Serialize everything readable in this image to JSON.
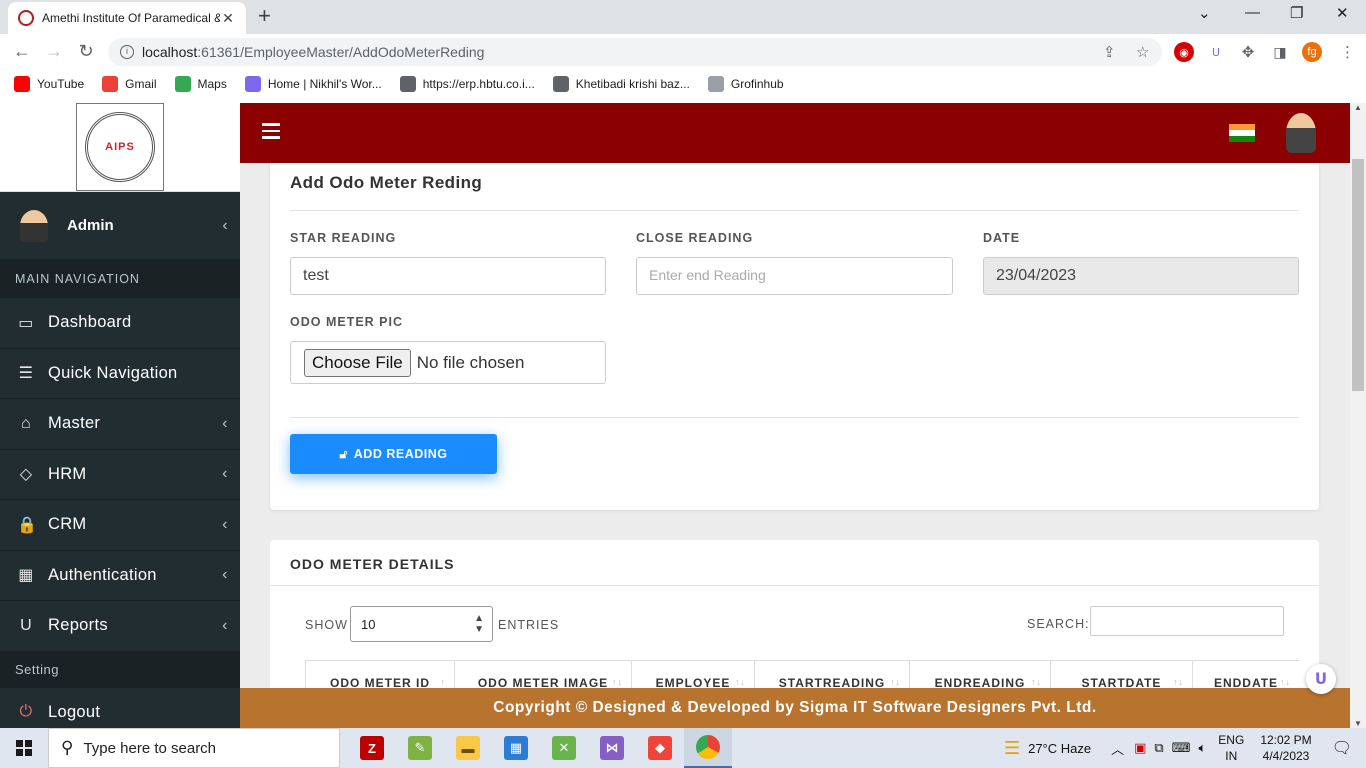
{
  "browser": {
    "tab_title": "Amethi Institute Of Paramedical &",
    "url_host": "localhost",
    "url_rest": ":61361/EmployeeMaster/AddOdoMeterReding",
    "profile_initials": "fg"
  },
  "bookmarks": [
    {
      "label": "YouTube",
      "color": "#ff0000",
      "icon": "youtube-icon"
    },
    {
      "label": "Gmail",
      "color": "#ea4335",
      "icon": "gmail-icon"
    },
    {
      "label": "Maps",
      "color": "#34a853",
      "icon": "maps-icon"
    },
    {
      "label": "Home | Nikhil's Wor...",
      "color": "#7b68ee",
      "icon": "clickup-icon"
    },
    {
      "label": "https://erp.hbtu.co.i...",
      "color": "#5f6368",
      "icon": "globe-icon"
    },
    {
      "label": "Khetibadi krishi baz...",
      "color": "#5f6368",
      "icon": "globe-icon"
    },
    {
      "label": "Grofinhub",
      "color": "#9aa0a6",
      "icon": "page-icon"
    }
  ],
  "sidebar": {
    "logo_text": "AIPS",
    "user_name": "Admin",
    "nav_header": "MAIN NAVIGATION",
    "items": [
      {
        "label": "Dashboard",
        "icon": "▭",
        "has_arrow": false
      },
      {
        "label": "Quick Navigation",
        "icon": "☰",
        "has_arrow": false
      },
      {
        "label": "Master",
        "icon": "⌂",
        "has_arrow": true
      },
      {
        "label": "HRM",
        "icon": "◇",
        "has_arrow": true
      },
      {
        "label": "CRM",
        "icon": "🔒",
        "has_arrow": true
      },
      {
        "label": "Authentication",
        "icon": "▦",
        "has_arrow": true
      },
      {
        "label": "Reports",
        "icon": "U",
        "has_arrow": true
      }
    ],
    "setting_label": "Setting",
    "logout_label": "Logout"
  },
  "form": {
    "title": "Add Odo Meter Reding",
    "star_reading_label": "STAR READING",
    "star_reading_value": "test",
    "close_reading_label": "CLOSE READING",
    "close_reading_placeholder": "Enter end Reading",
    "date_label": "DATE",
    "date_value": "23/04/2023",
    "pic_label": "ODO METER PIC",
    "choose_file_label": "Choose File",
    "no_file_label": "No file chosen",
    "submit_label": "ADD READING"
  },
  "details": {
    "title": "ODO METER DETAILS",
    "show_label": "SHOW",
    "entries_value": "10",
    "entries_label": "ENTRIES",
    "search_label": "SEARCH:",
    "columns": [
      "ODO METER ID",
      "ODO METER IMAGE",
      "EMPLOYEE",
      "STARTREADING",
      "ENDREADING",
      "STARTDATE",
      "ENDDATE"
    ]
  },
  "footer": "Copyright © Designed & Developed by Sigma IT Software Designers Pvt. Ltd.",
  "taskbar": {
    "search_placeholder": "Type here to search",
    "weather": "27°C  Haze",
    "lang_top": "ENG",
    "lang_bottom": "IN",
    "time": "12:02 PM",
    "date": "4/4/2023"
  },
  "colors": {
    "topbar": "#8b0000",
    "sidebar": "#222d32",
    "footer": "#b8732f",
    "primary_button": "#1a8cff"
  }
}
